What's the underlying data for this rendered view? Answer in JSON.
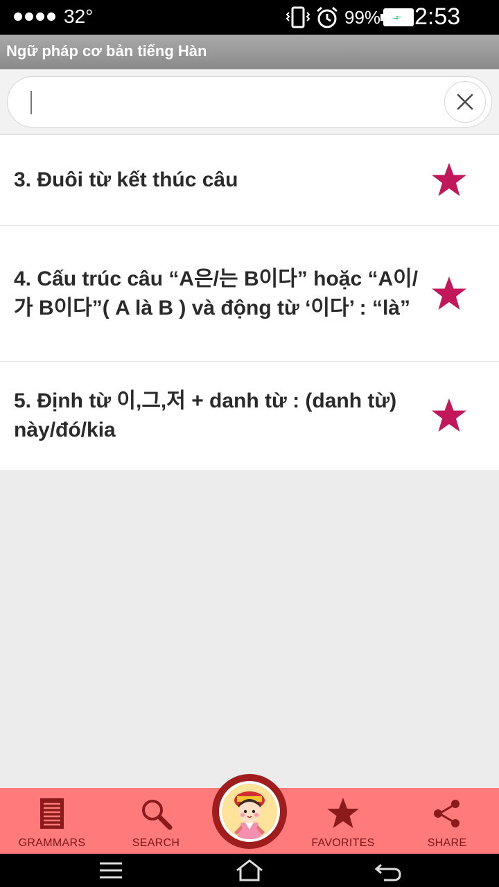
{
  "status_bar": {
    "temperature": "32°",
    "battery_percent": "99%",
    "time": "2:53 PM"
  },
  "app": {
    "title": "Ngữ pháp cơ bản tiếng Hàn"
  },
  "search": {
    "value": "",
    "placeholder": ""
  },
  "grammar_list": [
    {
      "label": "3. Đuôi từ kết thúc câu",
      "favorited": true
    },
    {
      "label": "4. Cấu trúc câu “A은/는 B이다” hoặc “A이/가 B이다”( A là B ) và động từ ‘이다’ : “là”",
      "favorited": true
    },
    {
      "label": "5. Định từ 이,그,저 + danh từ : (danh từ) này/đó/kia",
      "favorited": true
    }
  ],
  "bottom_nav": {
    "grammars": "GRAMMARS",
    "search": "SEARCH",
    "favorites": "FAVORITES",
    "share": "SHARE"
  },
  "colors": {
    "star": "#c2185b",
    "nav_background": "#ff7a7a",
    "nav_icon": "#8b1a1a",
    "title_bar": "#9a9a9a"
  }
}
